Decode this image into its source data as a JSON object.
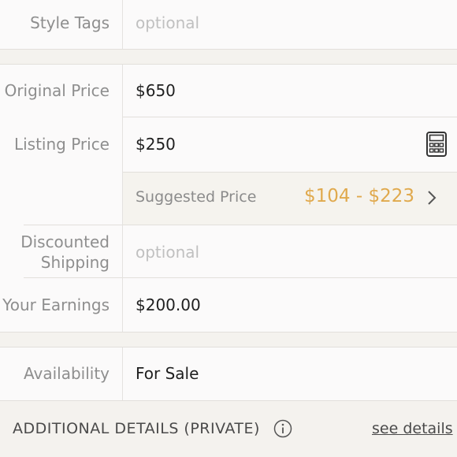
{
  "style_tags": {
    "label": "Style Tags",
    "placeholder": "optional"
  },
  "original_price": {
    "label": "Original Price",
    "value": "$650"
  },
  "listing_price": {
    "label": "Listing Price",
    "value": "$250",
    "icon": "calculator-icon"
  },
  "suggested_price": {
    "label": "Suggested Price",
    "range": "$104 - $223",
    "icon": "chevron-right-icon",
    "range_color": "#e0a94d"
  },
  "discounted_shipping": {
    "label_line1": "Discounted",
    "label_line2": "Shipping",
    "placeholder": "optional"
  },
  "earnings": {
    "label": "Your Earnings",
    "value": "$200.00"
  },
  "availability": {
    "label": "Availability",
    "value": "For Sale"
  },
  "additional_details": {
    "title": "ADDITIONAL DETAILS (PRIVATE)",
    "icon": "info-icon",
    "link": "see details"
  }
}
